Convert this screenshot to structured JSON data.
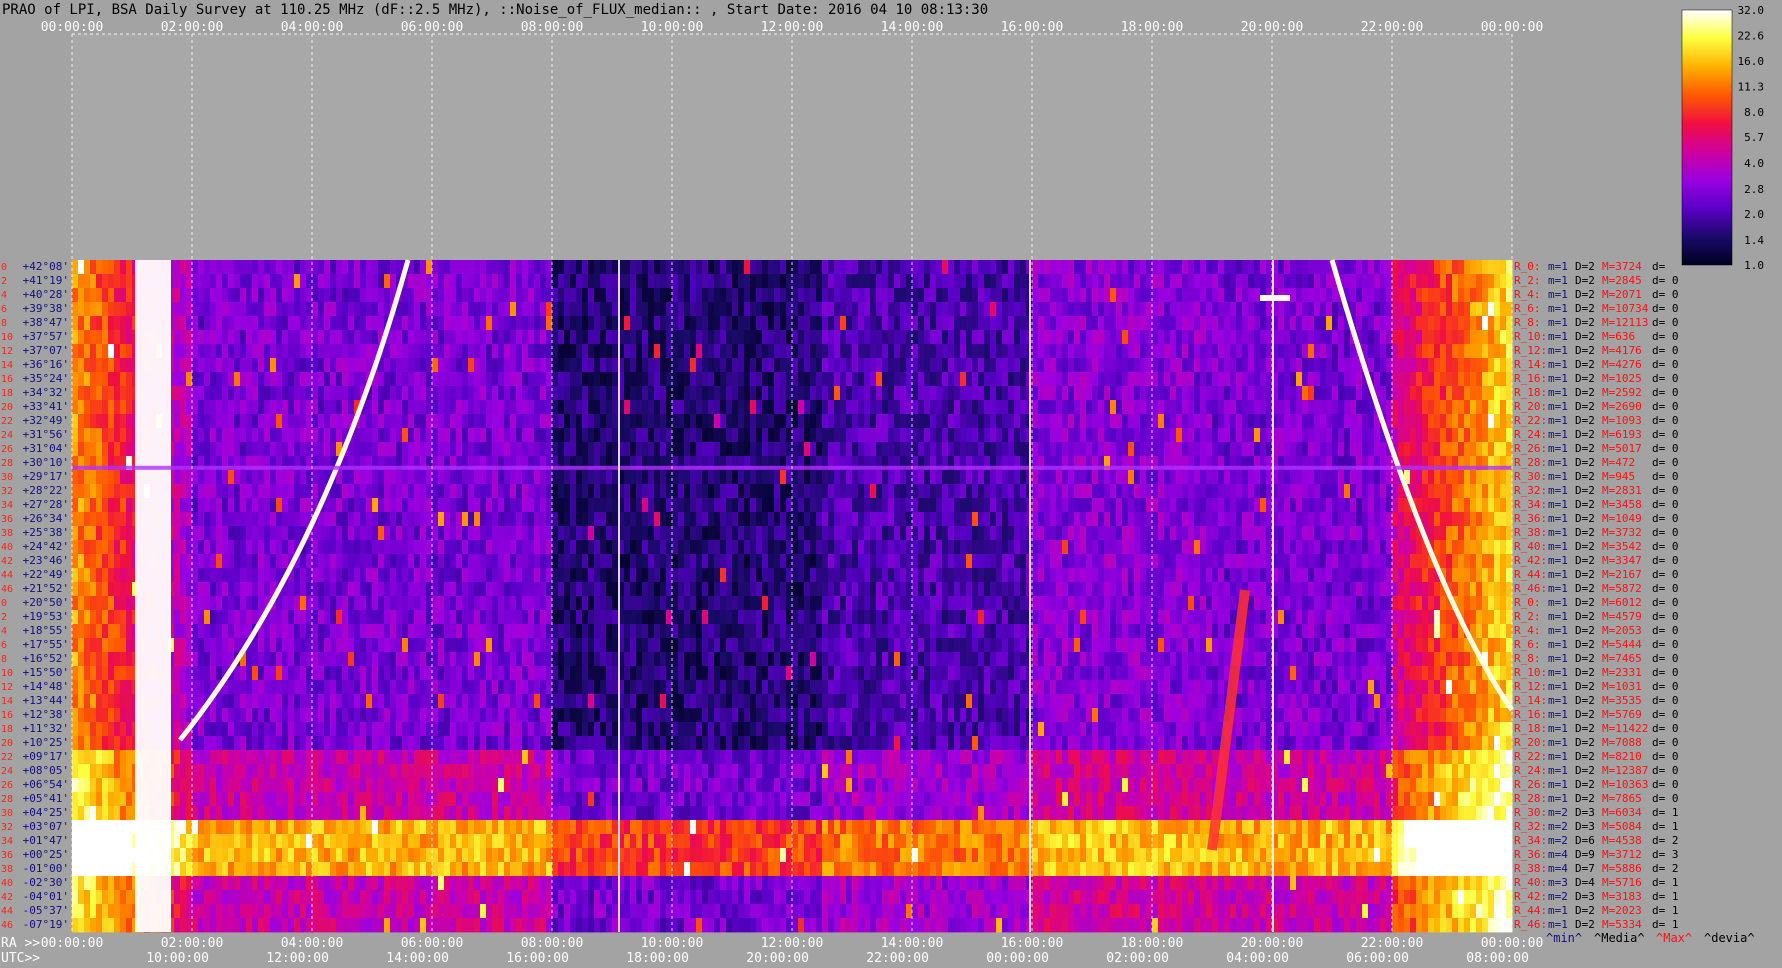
{
  "title": "PRAO of LPI, BSA Daily Survey at 110.25 MHz (dF::2.5 MHz), ::Noise_of_FLUX_median:: , Start Date: 2016 04 10 08:13:30",
  "chart_data": {
    "type": "heatmap",
    "top_time_labels": [
      "00:00:00",
      "02:00:00",
      "04:00:00",
      "06:00:00",
      "08:00:00",
      "10:00:00",
      "12:00:00",
      "14:00:00",
      "16:00:00",
      "18:00:00",
      "20:00:00",
      "22:00:00",
      "00:00:00"
    ],
    "bottom_ra_prefix": "RA >>",
    "bottom_ra_labels": [
      "00:00:00",
      "02:00:00",
      "04:00:00",
      "06:00:00",
      "08:00:00",
      "10:00:00",
      "12:00:00",
      "14:00:00",
      "16:00:00",
      "18:00:00",
      "20:00:00",
      "22:00:00",
      "00:00:00"
    ],
    "bottom_utc_prefix": "UTC>>",
    "bottom_utc_labels": [
      "10:00:00",
      "12:00:00",
      "14:00:00",
      "16:00:00",
      "18:00:00",
      "20:00:00",
      "22:00:00",
      "00:00:00",
      "02:00:00",
      "04:00:00",
      "06:00:00",
      "08:00:00"
    ],
    "row_index_labels": [
      "0",
      "2",
      "4",
      "6",
      "8",
      "10",
      "12",
      "14",
      "16",
      "18",
      "20",
      "22",
      "24",
      "26",
      "28",
      "30",
      "32",
      "34",
      "36",
      "38",
      "40",
      "42",
      "44",
      "46",
      "0",
      "2",
      "4",
      "6",
      "8",
      "10",
      "12",
      "14",
      "16",
      "18",
      "20",
      "22",
      "24",
      "26",
      "28",
      "30",
      "32",
      "34",
      "36",
      "38",
      "40",
      "42",
      "44",
      "46"
    ],
    "declination_labels": [
      "+42°08'",
      "+41°19'",
      "+40°28'",
      "+39°38'",
      "+38°47'",
      "+37°57'",
      "+37°07'",
      "+36°16'",
      "+35°24'",
      "+34°32'",
      "+33°41'",
      "+32°49'",
      "+31°56'",
      "+31°04'",
      "+30°10'",
      "+29°17'",
      "+28°22'",
      "+27°28'",
      "+26°34'",
      "+25°38'",
      "+24°42'",
      "+23°46'",
      "+22°49'",
      "+21°52'",
      "+20°50'",
      "+19°53'",
      "+18°55'",
      "+17°55'",
      "+16°52'",
      "+15°50'",
      "+14°48'",
      "+13°44'",
      "+12°38'",
      "+11°32'",
      "+10°25'",
      "+09°17'",
      "+08°05'",
      "+06°54'",
      "+05°41'",
      "+04°25'",
      "+03°07'",
      "+01°47'",
      "+00°25'",
      "-01°00'",
      "-02°30'",
      "-04°01'",
      "-05°37'",
      "-07°19'"
    ],
    "row_stats": [
      {
        "r": "R_0:",
        "m": "m=1",
        "D": "D=2",
        "M": "M=3724",
        "d": "d="
      },
      {
        "r": "R_2:",
        "m": "m=1",
        "D": "D=2",
        "M": "M=2845",
        "d": "d= 0"
      },
      {
        "r": "R_4:",
        "m": "m=1",
        "D": "D=2",
        "M": "M=2071",
        "d": "d= 0"
      },
      {
        "r": "R_6:",
        "m": "m=1",
        "D": "D=2",
        "M": "M=10734",
        "d": "d= 0"
      },
      {
        "r": "R_8:",
        "m": "m=1",
        "D": "D=2",
        "M": "M=12113",
        "d": "d= 0"
      },
      {
        "r": "R_10:",
        "m": "m=1",
        "D": "D=2",
        "M": "M=636",
        "d": "d= 0"
      },
      {
        "r": "R_12:",
        "m": "m=1",
        "D": "D=2",
        "M": "M=4176",
        "d": "d= 0"
      },
      {
        "r": "R_14:",
        "m": "m=1",
        "D": "D=2",
        "M": "M=4276",
        "d": "d= 0"
      },
      {
        "r": "R_16:",
        "m": "m=1",
        "D": "D=2",
        "M": "M=1025",
        "d": "d= 0"
      },
      {
        "r": "R_18:",
        "m": "m=1",
        "D": "D=2",
        "M": "M=2592",
        "d": "d= 0"
      },
      {
        "r": "R_20:",
        "m": "m=1",
        "D": "D=2",
        "M": "M=2690",
        "d": "d= 0"
      },
      {
        "r": "R_22:",
        "m": "m=1",
        "D": "D=2",
        "M": "M=1093",
        "d": "d= 0"
      },
      {
        "r": "R_24:",
        "m": "m=1",
        "D": "D=2",
        "M": "M=6193",
        "d": "d= 0"
      },
      {
        "r": "R_26:",
        "m": "m=1",
        "D": "D=2",
        "M": "M=5017",
        "d": "d= 0"
      },
      {
        "r": "R_28:",
        "m": "m=1",
        "D": "D=2",
        "M": "M=472",
        "d": "d= 0"
      },
      {
        "r": "R_30:",
        "m": "m=1",
        "D": "D=2",
        "M": "M=945",
        "d": "d= 0"
      },
      {
        "r": "R_32:",
        "m": "m=1",
        "D": "D=2",
        "M": "M=2831",
        "d": "d= 0"
      },
      {
        "r": "R_34:",
        "m": "m=1",
        "D": "D=2",
        "M": "M=3458",
        "d": "d= 0"
      },
      {
        "r": "R_36:",
        "m": "m=1",
        "D": "D=2",
        "M": "M=1049",
        "d": "d= 0"
      },
      {
        "r": "R_38:",
        "m": "m=1",
        "D": "D=2",
        "M": "M=3732",
        "d": "d= 0"
      },
      {
        "r": "R_40:",
        "m": "m=1",
        "D": "D=2",
        "M": "M=3542",
        "d": "d= 0"
      },
      {
        "r": "R_42:",
        "m": "m=1",
        "D": "D=2",
        "M": "M=3347",
        "d": "d= 0"
      },
      {
        "r": "R_44:",
        "m": "m=1",
        "D": "D=2",
        "M": "M=2167",
        "d": "d= 0"
      },
      {
        "r": "R_46:",
        "m": "m=1",
        "D": "D=2",
        "M": "M=5872",
        "d": "d= 0"
      },
      {
        "r": "R_0:",
        "m": "m=1",
        "D": "D=2",
        "M": "M=6012",
        "d": "d= 0"
      },
      {
        "r": "R_2:",
        "m": "m=1",
        "D": "D=2",
        "M": "M=4579",
        "d": "d= 0"
      },
      {
        "r": "R_4:",
        "m": "m=1",
        "D": "D=2",
        "M": "M=2053",
        "d": "d= 0"
      },
      {
        "r": "R_6:",
        "m": "m=1",
        "D": "D=2",
        "M": "M=5444",
        "d": "d= 0"
      },
      {
        "r": "R_8:",
        "m": "m=1",
        "D": "D=2",
        "M": "M=7465",
        "d": "d= 0"
      },
      {
        "r": "R_10:",
        "m": "m=1",
        "D": "D=2",
        "M": "M=2331",
        "d": "d= 0"
      },
      {
        "r": "R_12:",
        "m": "m=1",
        "D": "D=2",
        "M": "M=1031",
        "d": "d= 0"
      },
      {
        "r": "R_14:",
        "m": "m=1",
        "D": "D=2",
        "M": "M=3535",
        "d": "d= 0"
      },
      {
        "r": "R_16:",
        "m": "m=1",
        "D": "D=2",
        "M": "M=5769",
        "d": "d= 0"
      },
      {
        "r": "R_18:",
        "m": "m=1",
        "D": "D=2",
        "M": "M=11422",
        "d": "d= 0"
      },
      {
        "r": "R_20:",
        "m": "m=1",
        "D": "D=2",
        "M": "M=7088",
        "d": "d= 0"
      },
      {
        "r": "R_22:",
        "m": "m=1",
        "D": "D=2",
        "M": "M=8210",
        "d": "d= 0"
      },
      {
        "r": "R_24:",
        "m": "m=1",
        "D": "D=2",
        "M": "M=12387",
        "d": "d= 0"
      },
      {
        "r": "R_26:",
        "m": "m=1",
        "D": "D=2",
        "M": "M=10363",
        "d": "d= 0"
      },
      {
        "r": "R_28:",
        "m": "m=1",
        "D": "D=2",
        "M": "M=7865",
        "d": "d= 0"
      },
      {
        "r": "R_30:",
        "m": "m=2",
        "D": "D=3",
        "M": "M=6034",
        "d": "d= 1"
      },
      {
        "r": "R_32:",
        "m": "m=2",
        "D": "D=3",
        "M": "M=5084",
        "d": "d= 1"
      },
      {
        "r": "R_34:",
        "m": "m=2",
        "D": "D=6",
        "M": "M=4538",
        "d": "d= 2"
      },
      {
        "r": "R_36:",
        "m": "m=4",
        "D": "D=9",
        "M": "M=3712",
        "d": "d= 3"
      },
      {
        "r": "R_38:",
        "m": "m=4",
        "D": "D=7",
        "M": "M=5886",
        "d": "d= 2"
      },
      {
        "r": "R_40:",
        "m": "m=3",
        "D": "D=4",
        "M": "M=5716",
        "d": "d= 1"
      },
      {
        "r": "R_42:",
        "m": "m=2",
        "D": "D=3",
        "M": "M=3183",
        "d": "d= 1"
      },
      {
        "r": "R_44:",
        "m": "m=1",
        "D": "D=2",
        "M": "M=2023",
        "d": "d= 1"
      },
      {
        "r": "R_46:",
        "m": "m=1",
        "D": "D=2",
        "M": "M=5334",
        "d": "d= 1"
      }
    ],
    "stats_legend": [
      "^min^",
      "^Media^",
      "^Max^",
      "^devia^"
    ],
    "colorbar": {
      "ticks": [
        "32.0",
        "22.6",
        "16.0",
        "11.3",
        "8.0",
        "5.7",
        "4.0",
        "2.8",
        "2.0",
        "1.4",
        "1.0"
      ],
      "min": 1.0,
      "max": 32.0,
      "scale": "log",
      "stops": [
        "#000020",
        "#1a0a6a",
        "#5a00c8",
        "#9a00e0",
        "#d000a0",
        "#f01040",
        "#ff5a00",
        "#ffb000",
        "#ffff40",
        "#ffffff"
      ]
    },
    "x_range": [
      0,
      24
    ],
    "grid": true
  },
  "colors": {
    "background": "#a3a3a3",
    "row_label_red": "#ff2020",
    "declination_text": "#101080",
    "stats_dark": "#101080",
    "stats_red": "#ff1010"
  }
}
